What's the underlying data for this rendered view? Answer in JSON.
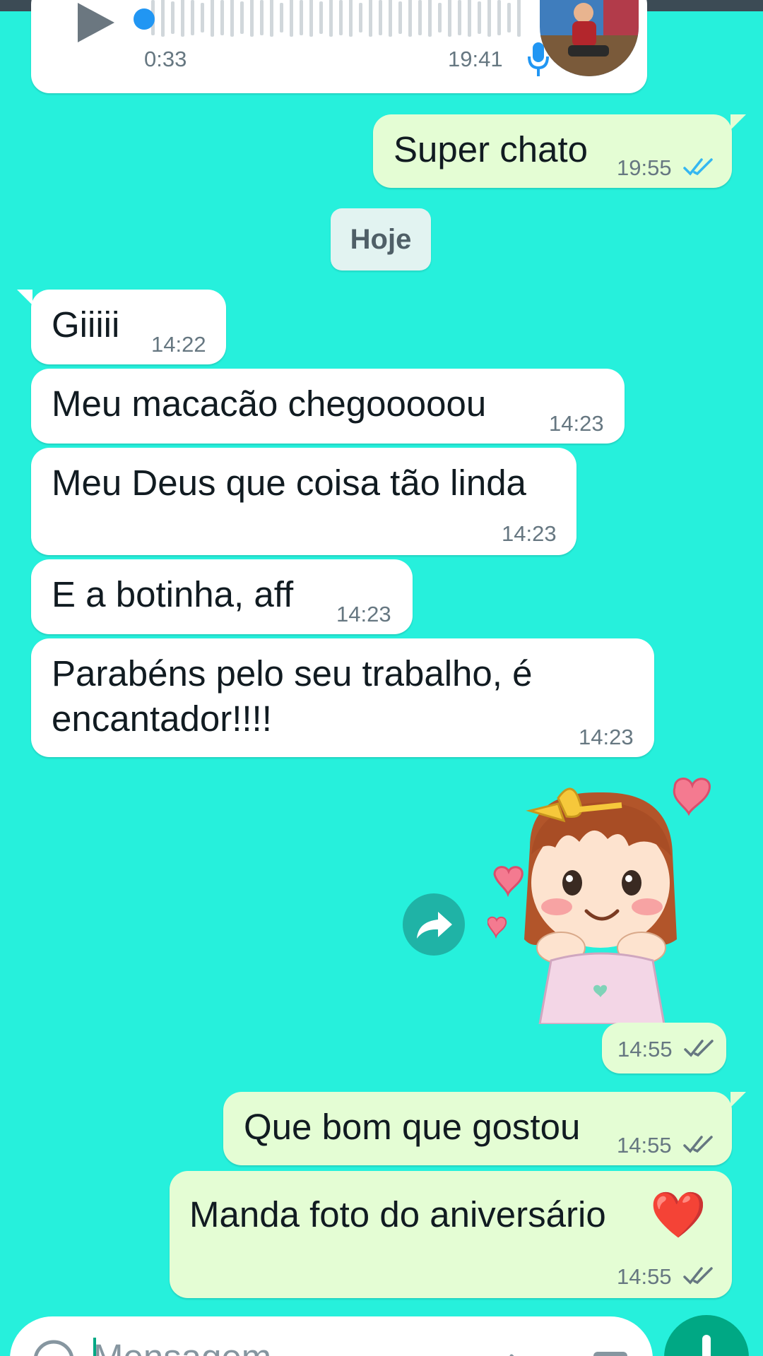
{
  "voice_message": {
    "duration": "0:33",
    "time": "19:41"
  },
  "messages": [
    {
      "id": "m1",
      "text": "Super chato",
      "time": "19:55"
    },
    {
      "id": "m2",
      "text": "Giiiii",
      "time": "14:22"
    },
    {
      "id": "m3",
      "text": "Meu macacão chegooooou",
      "time": "14:23"
    },
    {
      "id": "m4",
      "text": "Meu Deus que coisa tão linda",
      "time": "14:23"
    },
    {
      "id": "m5",
      "text": "E a botinha, aff",
      "time": "14:23"
    },
    {
      "id": "m6",
      "line1": "Parabéns pelo seu trabalho, é",
      "line2": "encantador!!!!",
      "time": "14:23"
    },
    {
      "id": "m7",
      "time": "14:55"
    },
    {
      "id": "m8",
      "text": "Que bom que gostou",
      "time": "14:55"
    },
    {
      "id": "m9",
      "text": "Manda foto do aniversário",
      "emoji": "❤️",
      "time": "14:55"
    }
  ],
  "date_divider": "Hoje",
  "composer": {
    "placeholder": "Mensagem"
  },
  "colors": {
    "background": "#26f0dc",
    "incoming": "#ffffff",
    "outgoing": "#e4fdd4",
    "read_ticks": "#34b7f1",
    "delivered_ticks": "#667781",
    "accent": "#00a884"
  }
}
